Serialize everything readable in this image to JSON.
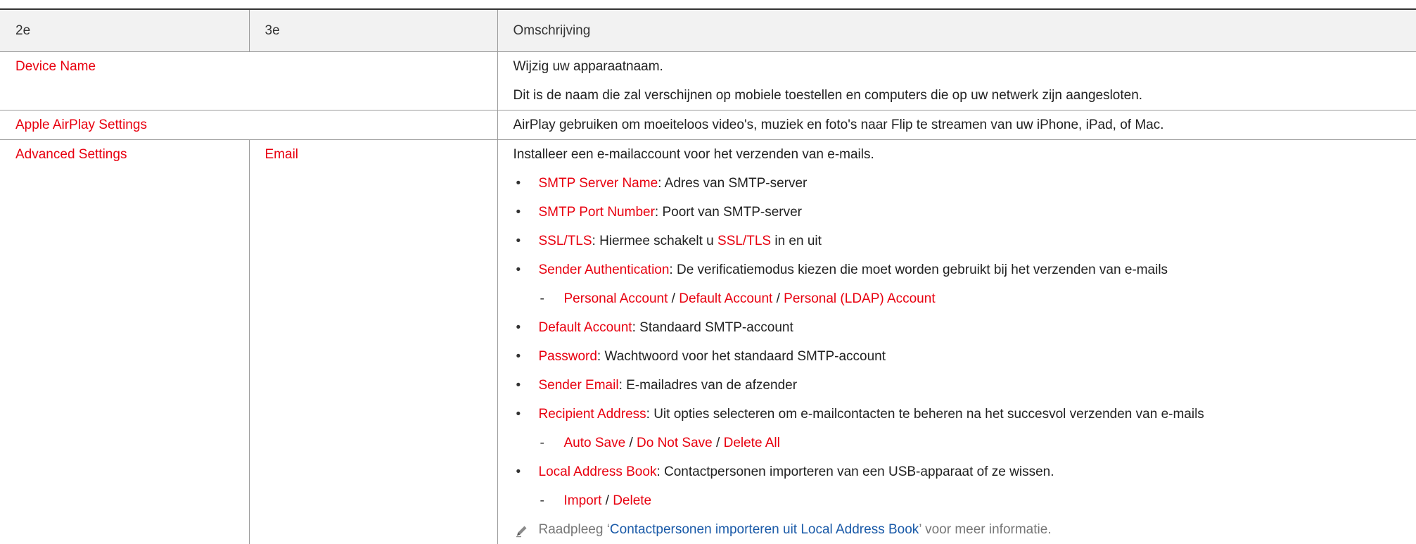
{
  "table": {
    "headers": [
      "2e",
      "3e",
      "Omschrijving"
    ],
    "device_name": {
      "label": "Device Name",
      "lines": [
        "Wijzig uw apparaatnaam.",
        "Dit is de naam die zal verschijnen op mobiele toestellen en computers die op uw netwerk zijn aangesloten."
      ]
    },
    "airplay": {
      "label": "Apple AirPlay Settings",
      "line": "AirPlay gebruiken om moeiteloos video's, muziek en foto's naar Flip te streamen van uw iPhone, iPad, of Mac."
    },
    "advanced": {
      "label": "Advanced Settings",
      "sub_label": "Email",
      "intro": "Installeer een e-mailaccount voor het verzenden van e-mails.",
      "smtp_server": {
        "term": "SMTP Server Name",
        "desc": ": Adres van SMTP-server"
      },
      "smtp_port": {
        "term": "SMTP Port Number",
        "desc": ": Poort van SMTP-server"
      },
      "ssl": {
        "term": "SSL/TLS",
        "desc_a": ": Hiermee schakelt u ",
        "term2": "SSL/TLS",
        "desc_b": " in en uit"
      },
      "sender_auth": {
        "term": "Sender Authentication",
        "desc": ": De verificatiemodus kiezen die moet worden gebruikt bij het verzenden van e-mails"
      },
      "auth_options": {
        "a": "Personal Account",
        "sep1": " / ",
        "b": "Default Account",
        "sep2": " / ",
        "c": "Personal (LDAP) Account"
      },
      "default_account": {
        "term": "Default Account",
        "desc": ": Standaard SMTP-account"
      },
      "password": {
        "term": "Password",
        "desc": ": Wachtwoord voor het standaard SMTP-account"
      },
      "sender_email": {
        "term": "Sender Email",
        "desc": ": E-mailadres van de afzender"
      },
      "recipient": {
        "term": "Recipient Address",
        "desc": ": Uit opties selecteren om e-mailcontacten te beheren na het succesvol verzenden van e-mails"
      },
      "recipient_options": {
        "a": "Auto Save",
        "sep1": " / ",
        "b": "Do Not Save",
        "sep2": " / ",
        "c": "Delete All"
      },
      "address_book": {
        "term": "Local Address Book",
        "desc": ": Contactpersonen importeren van een USB-apparaat of ze wissen."
      },
      "book_options": {
        "a": "Import",
        "sep1": " / ",
        "b": "Delete"
      },
      "note": {
        "pre": "Raadpleeg ‘",
        "link": "Contactpersonen importeren uit Local Address Book",
        "post": "’ voor meer informatie."
      }
    }
  },
  "icons": {
    "note": "pencil-note-icon"
  },
  "colors": {
    "term": "#e8000f",
    "link": "#1a5aa8",
    "header_bg": "#f2f2f2"
  }
}
